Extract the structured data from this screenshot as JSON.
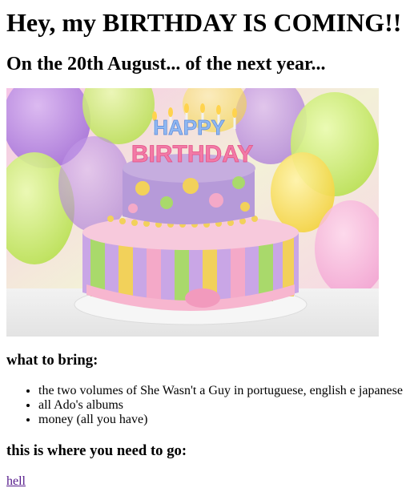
{
  "header": {
    "title": "Hey, my BIRTHDAY IS COMING!!",
    "subtitle": "On the 20th August... of the next year..."
  },
  "hero_image": {
    "cake_text_top": "HAPPY",
    "cake_text_bottom": "BIRTHDAY"
  },
  "bring": {
    "heading": "what to bring:",
    "items": [
      "the two volumes of She Wasn't a Guy in portuguese, english e japanese",
      "all Ado's albums",
      "money (all you have)"
    ]
  },
  "location": {
    "heading": "this is where you need to go:",
    "link_text": "hell"
  },
  "colors": {
    "link_visited": "#551a8b",
    "cake_purple": "#a98fd6",
    "cake_pink": "#f4a9c8",
    "cake_yellow": "#f2d15a",
    "cake_green": "#a9d96b"
  }
}
